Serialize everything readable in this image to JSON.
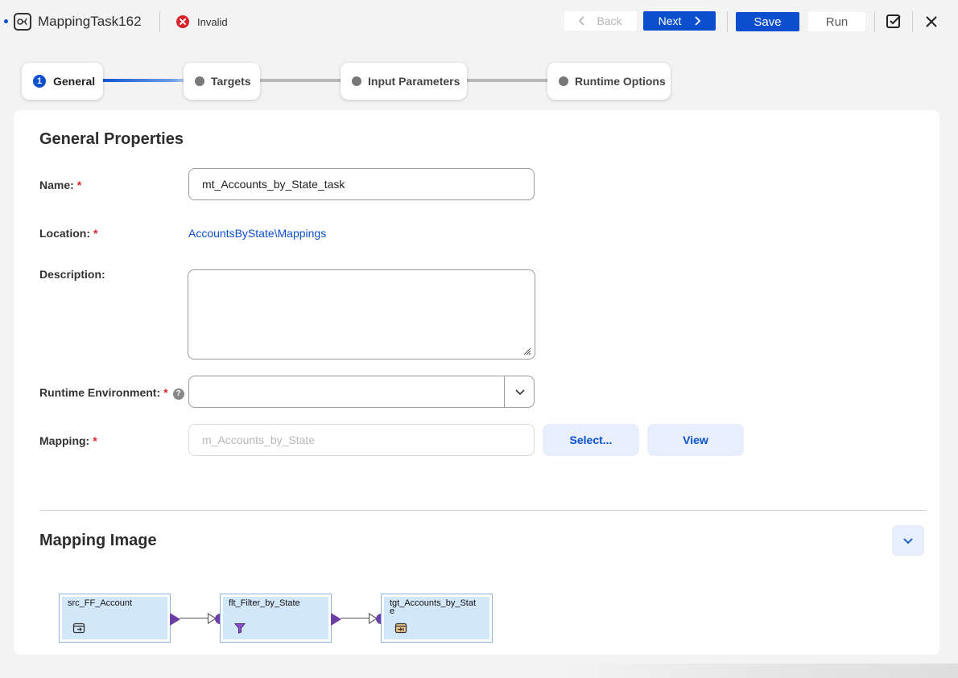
{
  "header": {
    "title": "MappingTask162",
    "status": "Invalid",
    "back_label": "Back",
    "next_label": "Next",
    "save_label": "Save",
    "run_label": "Run",
    "icons": [
      "mapping-task-icon",
      "invalid-status-icon",
      "validate-icon",
      "close-icon"
    ]
  },
  "stepper": {
    "steps": [
      {
        "number": "1",
        "label": "General",
        "state": "active"
      },
      {
        "label": "Targets",
        "state": "pending"
      },
      {
        "label": "Input Parameters",
        "state": "pending"
      },
      {
        "label": "Runtime Options",
        "state": "pending"
      }
    ]
  },
  "general": {
    "section_title": "General Properties",
    "name_label": "Name:",
    "name_value": "mt_Accounts_by_State_task",
    "location_label": "Location:",
    "location_value": "AccountsByState\\Mappings",
    "description_label": "Description:",
    "description_value": "",
    "runtime_label": "Runtime Environment:",
    "runtime_value": "",
    "mapping_label": "Mapping:",
    "mapping_value": "m_Accounts_by_State",
    "select_label": "Select...",
    "view_label": "View",
    "required_mark": "*",
    "help_mark": "?"
  },
  "mapping_image": {
    "section_title": "Mapping Image",
    "nodes": [
      {
        "name": "src_FF_Account",
        "icon": "source-icon"
      },
      {
        "name": "flt_Filter_by_State",
        "icon": "filter-icon"
      },
      {
        "name": "tgt_Accounts_by_State",
        "icon": "target-icon"
      }
    ]
  },
  "colors": {
    "primary": "#0b4fce",
    "error": "#d8232a",
    "port": "#6d3fa5",
    "node_fill": "#d3e7fa"
  }
}
